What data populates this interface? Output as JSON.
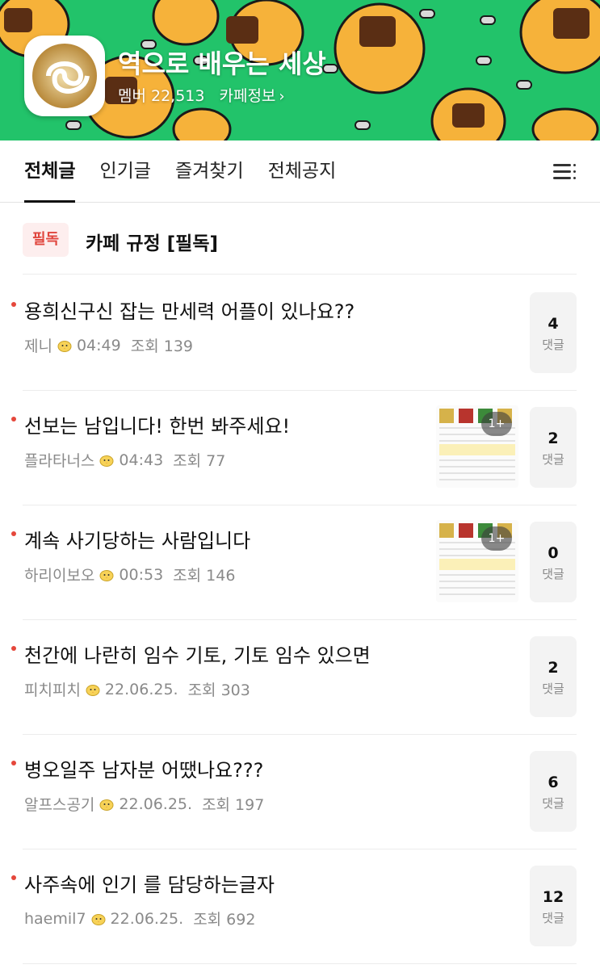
{
  "cafe": {
    "title": "역으로 배우는 세상",
    "member_label": "멤버 22,513",
    "info_label": "카페정보",
    "info_chevron": "›"
  },
  "tabs": [
    {
      "label": "전체글",
      "active": true
    },
    {
      "label": "인기글",
      "active": false
    },
    {
      "label": "즐겨찾기",
      "active": false
    },
    {
      "label": "전체공지",
      "active": false
    }
  ],
  "notice": {
    "badge": "필독",
    "title": "카페 규정 [필독]"
  },
  "posts": [
    {
      "title": "용희신구신 잡는 만세력 어플이 있나요??",
      "author": "제니",
      "time": "04:49",
      "views": "조회 139",
      "comments": "4",
      "comment_label": "댓글",
      "has_thumb": false
    },
    {
      "title": "선보는 남입니다! 한번 봐주세요!",
      "author": "플라타너스",
      "time": "04:43",
      "views": "조회 77",
      "comments": "2",
      "comment_label": "댓글",
      "has_thumb": true,
      "thumb_more": "1+"
    },
    {
      "title": "계속 사기당하는 사람입니다",
      "author": "하리이보오",
      "time": "00:53",
      "views": "조회 146",
      "comments": "0",
      "comment_label": "댓글",
      "has_thumb": true,
      "thumb_more": "1+"
    },
    {
      "title": "천간에 나란히 임수 기토, 기토 임수 있으면",
      "author": "피치피치",
      "time": "22.06.25.",
      "views": "조회 303",
      "comments": "2",
      "comment_label": "댓글",
      "has_thumb": false
    },
    {
      "title": "병오일주 남자분 어땠나요???",
      "author": "알프스공기",
      "time": "22.06.25.",
      "views": "조회 197",
      "comments": "6",
      "comment_label": "댓글",
      "has_thumb": false
    },
    {
      "title": "사주속에 인기 를 담당하는글자",
      "author": "haemil7",
      "time": "22.06.25.",
      "views": "조회 692",
      "comments": "12",
      "comment_label": "댓글",
      "has_thumb": false
    }
  ],
  "colors": {
    "banner_green": "#22c36a",
    "notice_red": "#e0463e",
    "dot_red": "#e5473b"
  }
}
